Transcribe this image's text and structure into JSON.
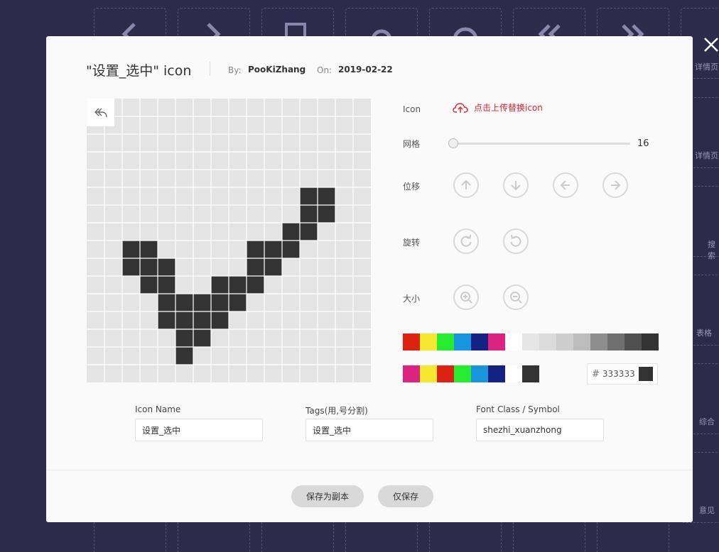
{
  "background": {
    "color": "#2e2a4b",
    "tiles": [
      {
        "icon": "chevron-left-icon"
      },
      {
        "icon": "chevron-right-icon"
      },
      {
        "icon": "edit-icon"
      },
      {
        "icon": "gear-icon"
      },
      {
        "icon": "help-icon"
      },
      {
        "icon": "double-chevron-left-icon"
      },
      {
        "icon": "double-chevron-right-icon"
      }
    ],
    "side_labels": [
      "详情页",
      "详情页",
      "搜索",
      "表格",
      "综合",
      "意见"
    ]
  },
  "dialog": {
    "title": "\"设置_选中\" icon",
    "by_label": "By:",
    "author": "PooKiZhang",
    "on_label": "On:",
    "date": "2019-02-22"
  },
  "editor": {
    "grid_size": 16,
    "fill_color": "#333333",
    "empty_color": "#e4e4e4",
    "pixels": [
      [
        12,
        5
      ],
      [
        13,
        5
      ],
      [
        12,
        6
      ],
      [
        13,
        6
      ],
      [
        11,
        7
      ],
      [
        12,
        7
      ],
      [
        10,
        8
      ],
      [
        11,
        8
      ],
      [
        2,
        8
      ],
      [
        3,
        8
      ],
      [
        9,
        8
      ],
      [
        2,
        9
      ],
      [
        3,
        9
      ],
      [
        4,
        9
      ],
      [
        9,
        9
      ],
      [
        10,
        9
      ],
      [
        3,
        10
      ],
      [
        4,
        10
      ],
      [
        7,
        10
      ],
      [
        8,
        10
      ],
      [
        9,
        10
      ],
      [
        4,
        11
      ],
      [
        5,
        11
      ],
      [
        6,
        11
      ],
      [
        7,
        11
      ],
      [
        8,
        11
      ],
      [
        4,
        12
      ],
      [
        5,
        12
      ],
      [
        6,
        12
      ],
      [
        7,
        12
      ],
      [
        5,
        13
      ],
      [
        6,
        13
      ],
      [
        5,
        14
      ]
    ]
  },
  "panel": {
    "icon_label": "Icon",
    "upload_text": "点击上传替换icon",
    "grid_label": "网格",
    "grid_value": "16",
    "move_label": "位移",
    "rotate_label": "旋转",
    "size_label": "大小",
    "palette_main": [
      "#dd2212",
      "#f5e82f",
      "#26ec30",
      "#1795df",
      "#142383",
      "#dc237f",
      "#ffffff",
      "#e6e6e6",
      "#dcdcdc",
      "#cdcdcd",
      "#bcbcbc",
      "#8e8e8e",
      "#6f6f6f",
      "#505050",
      "#333333"
    ],
    "palette_recent": [
      "#dc237f",
      "#f5e82f",
      "#dd2212",
      "#26ec30",
      "#1795df",
      "#142383",
      "#ffffff",
      "#333333"
    ],
    "hex_value": "333333",
    "hex_color": "#333333"
  },
  "fields": {
    "name_label": "Icon Name",
    "name_value": "设置_选中",
    "tags_label": "Tags(用,号分割)",
    "tags_value": "设置_选中",
    "font_label": "Font Class / Symbol",
    "font_value": "shezhi_xuanzhong"
  },
  "buttons": {
    "save_copy": "保存为副本",
    "save_only": "仅保存"
  },
  "accent": "#e0232d"
}
